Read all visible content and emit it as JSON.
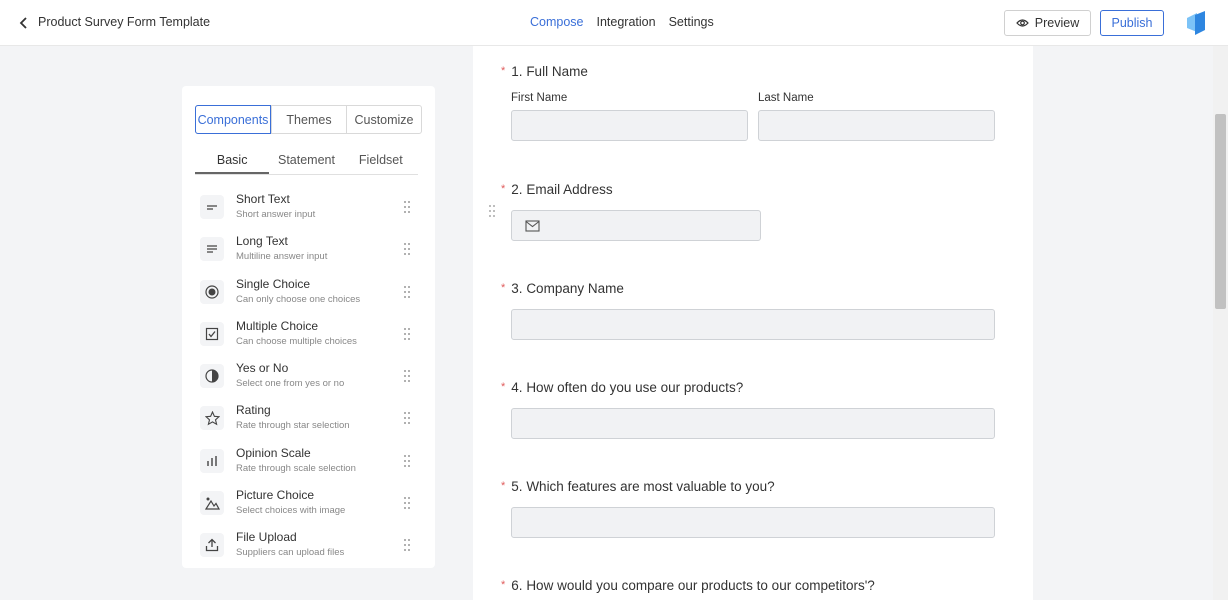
{
  "header": {
    "title": "Product Survey Form Template",
    "nav": [
      "Compose",
      "Integration",
      "Settings"
    ],
    "active_nav": 0,
    "preview_label": "Preview",
    "publish_label": "Publish"
  },
  "panel": {
    "top_tabs": [
      "Components",
      "Themes",
      "Customize"
    ],
    "sub_tabs": [
      "Basic",
      "Statement",
      "Fieldset"
    ],
    "components": [
      {
        "title": "Short Text",
        "desc": "Short answer input",
        "icon": "short-text-icon"
      },
      {
        "title": "Long Text",
        "desc": "Multiline answer input",
        "icon": "long-text-icon"
      },
      {
        "title": "Single Choice",
        "desc": "Can only choose one choices",
        "icon": "radio-icon"
      },
      {
        "title": "Multiple Choice",
        "desc": "Can choose multiple choices",
        "icon": "checkbox-icon"
      },
      {
        "title": "Yes or No",
        "desc": "Select one from yes or no",
        "icon": "yes-no-icon"
      },
      {
        "title": "Rating",
        "desc": "Rate through star selection",
        "icon": "star-icon"
      },
      {
        "title": "Opinion Scale",
        "desc": "Rate through scale selection",
        "icon": "bar-chart-icon"
      },
      {
        "title": "Picture Choice",
        "desc": "Select choices with image",
        "icon": "picture-icon"
      },
      {
        "title": "File Upload",
        "desc": "Suppliers can upload files",
        "icon": "upload-icon"
      }
    ]
  },
  "form": {
    "questions": [
      {
        "num": "1.",
        "label": "Full Name",
        "first_label": "First Name",
        "last_label": "Last Name"
      },
      {
        "num": "2.",
        "label": "Email Address"
      },
      {
        "num": "3.",
        "label": "Company Name"
      },
      {
        "num": "4.",
        "label": "How often do you use our products?"
      },
      {
        "num": "5.",
        "label": "Which features are most valuable to you?"
      },
      {
        "num": "6.",
        "label": "How would you compare our products to our competitors'?"
      }
    ],
    "required_mark": "*"
  },
  "colors": {
    "accent": "#3a6fd8",
    "required": "#e05b5b",
    "field_bg": "#f1f2f4"
  }
}
